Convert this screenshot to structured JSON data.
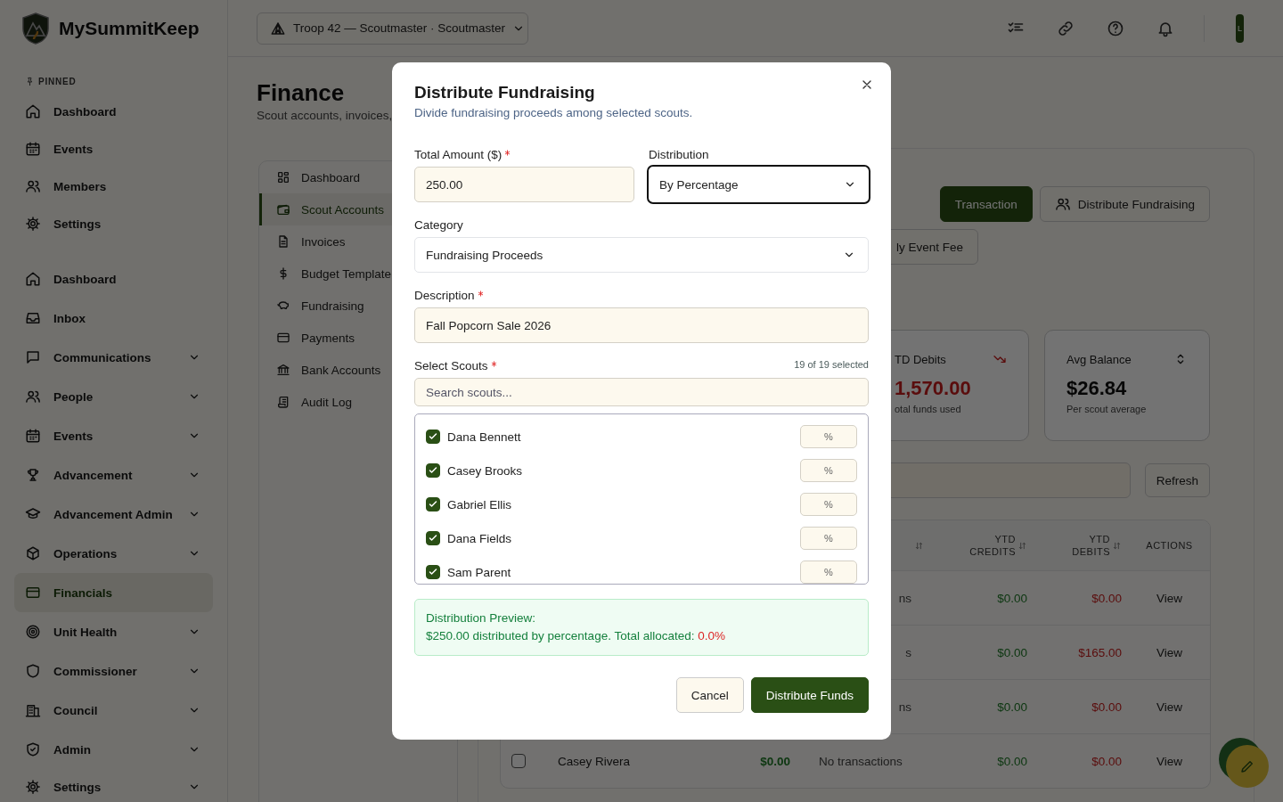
{
  "app": {
    "name": "MySummitKeep"
  },
  "sidebar": {
    "pinned_label": "PINNED",
    "pinned": [
      {
        "label": "Dashboard"
      },
      {
        "label": "Events"
      },
      {
        "label": "Members"
      },
      {
        "label": "Settings"
      }
    ],
    "items": [
      {
        "label": "Dashboard",
        "expandable": false,
        "selected": false
      },
      {
        "label": "Inbox",
        "expandable": false,
        "selected": false
      },
      {
        "label": "Communications",
        "expandable": true,
        "selected": false
      },
      {
        "label": "People",
        "expandable": true,
        "selected": false
      },
      {
        "label": "Events",
        "expandable": true,
        "selected": false
      },
      {
        "label": "Advancement",
        "expandable": true,
        "selected": false
      },
      {
        "label": "Advancement Admin",
        "expandable": true,
        "selected": false
      },
      {
        "label": "Operations",
        "expandable": true,
        "selected": false
      },
      {
        "label": "Financials",
        "expandable": false,
        "selected": true
      },
      {
        "label": "Unit Health",
        "expandable": true,
        "selected": false
      },
      {
        "label": "Commissioner",
        "expandable": true,
        "selected": false
      },
      {
        "label": "Council",
        "expandable": true,
        "selected": false
      },
      {
        "label": "Admin",
        "expandable": true,
        "selected": false
      },
      {
        "label": "Settings",
        "expandable": true,
        "selected": false
      }
    ]
  },
  "header": {
    "unit_selector": "Troop 42 — Scoutmaster · Scoutmaster",
    "avatar": "L"
  },
  "page": {
    "title": "Finance",
    "subtitle": "Scout accounts, invoices,"
  },
  "finance_nav": [
    {
      "label": "Dashboard",
      "selected": false
    },
    {
      "label": "Scout Accounts",
      "selected": true
    },
    {
      "label": "Invoices",
      "selected": false
    },
    {
      "label": "Budget Template",
      "selected": false
    },
    {
      "label": "Fundraising",
      "selected": false
    },
    {
      "label": "Payments",
      "selected": false
    },
    {
      "label": "Bank Accounts",
      "selected": false
    },
    {
      "label": "Audit Log",
      "selected": false
    }
  ],
  "action_rows": [
    [
      {
        "label": "Transaction",
        "kind": "primary"
      },
      {
        "label": "Distribute Fundraising",
        "kind": "people"
      }
    ],
    [
      {
        "label": "ly Event Fee",
        "kind": "secondary"
      }
    ]
  ],
  "stats": [
    {
      "label": "TD Debits",
      "value": "1,570.00",
      "note": "otal funds used"
    },
    {
      "label": "Avg Balance",
      "value": "$26.84",
      "note": "Per scout average"
    }
  ],
  "refresh_button": "Refresh",
  "table": {
    "columns": [
      {
        "sortable": true
      },
      {
        "label": "YTD CREDITS",
        "sortable": true
      },
      {
        "label": "YTD DEBITS",
        "sortable": true
      },
      {
        "label": "ACTIONS",
        "sortable": false
      }
    ],
    "rows": [
      {
        "activity": "ns",
        "credits": "$0.00",
        "debits": "$0.00",
        "action": "View"
      },
      {
        "activity": "s",
        "credits": "$0.00",
        "debits": "$165.00",
        "action": "View"
      },
      {
        "activity": "ns",
        "credits": "$0.00",
        "debits": "$0.00",
        "action": "View"
      },
      {
        "checked": false,
        "name": "Casey Rivera",
        "balance": "$0.00",
        "activity": "No transactions",
        "credits": "$0.00",
        "debits": "$0.00",
        "action": "View"
      }
    ]
  },
  "modal": {
    "title": "Distribute Fundraising",
    "subtitle": "Divide fundraising proceeds among selected scouts.",
    "amount": {
      "label": "Total Amount ($)",
      "required": true,
      "value": "250.00"
    },
    "distribution": {
      "label": "Distribution",
      "value": "By Percentage",
      "focused": true
    },
    "category": {
      "label": "Category",
      "value": "Fundraising Proceeds",
      "focused": false
    },
    "description": {
      "label": "Description",
      "required": true,
      "value": "Fall Popcorn Sale 2026"
    },
    "scouts": {
      "label": "Select Scouts",
      "required": true,
      "count": "19 of 19 selected",
      "search_placeholder": "Search scouts...",
      "list": [
        {
          "name": "Dana Bennett",
          "checked": true,
          "placeholder": "%"
        },
        {
          "name": "Casey Brooks",
          "checked": true,
          "placeholder": "%"
        },
        {
          "name": "Gabriel Ellis",
          "checked": true,
          "placeholder": "%"
        },
        {
          "name": "Dana Fields",
          "checked": true,
          "placeholder": "%"
        },
        {
          "name": "Sam Parent",
          "checked": true,
          "placeholder": "%"
        }
      ]
    },
    "preview": {
      "title": "Distribution Preview:",
      "text": "$250.00 distributed by percentage. Total allocated:",
      "total": "0.0%",
      "balanced": false
    },
    "buttons": [
      {
        "label": "Cancel",
        "kind": "secondary"
      },
      {
        "label": "Distribute Funds",
        "kind": "primary"
      }
    ]
  }
}
